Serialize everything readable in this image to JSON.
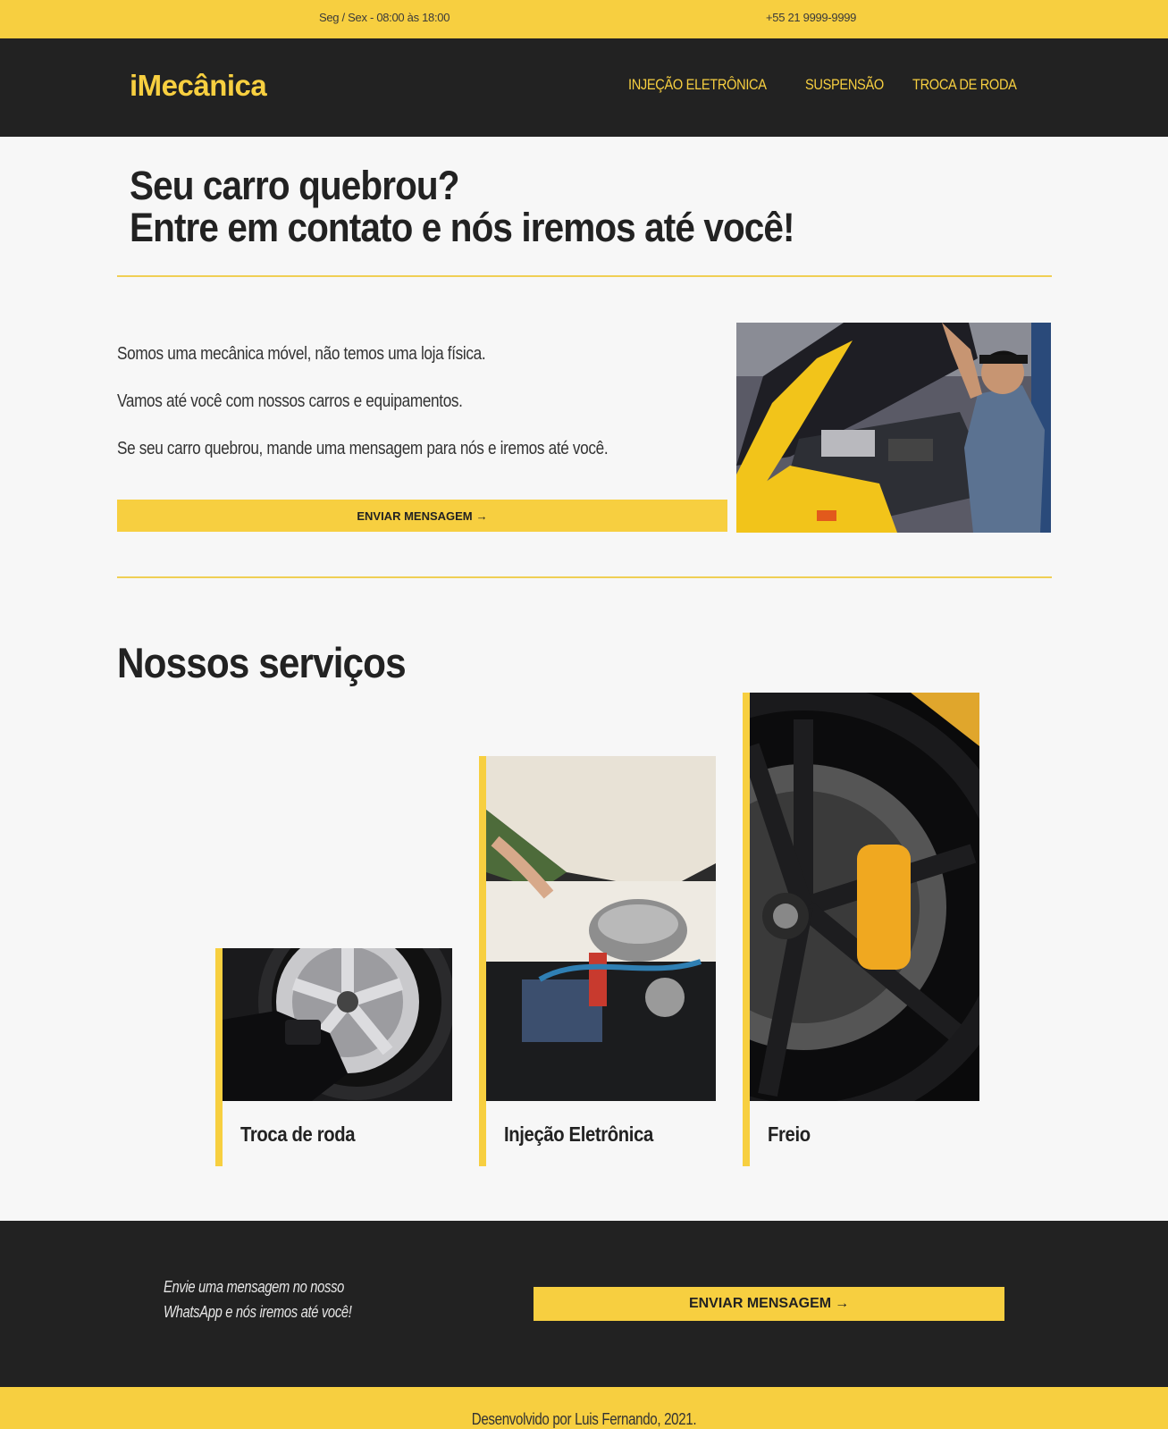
{
  "topbar": {
    "hours": "Seg / Sex - 08:00 às 18:00",
    "phone": "+55 21 9999-9999"
  },
  "header": {
    "logo": "iMecânica",
    "nav": [
      "Injeção Eletrônica",
      "Suspensão",
      "Troca de roda"
    ]
  },
  "hero": {
    "title_line1": "Seu carro quebrou?",
    "title_line2": "Entre em contato e nós iremos até você!"
  },
  "about": {
    "p1": "Somos uma mecânica móvel, não temos uma loja física.",
    "p2": "Vamos até você com nossos carros e equipamentos.",
    "p3": "Se seu carro quebrou, mande uma mensagem para nós e iremos até você.",
    "button": "ENVIAR MENSAGEM"
  },
  "services": {
    "title": "Nossos serviços",
    "items": [
      {
        "label": "Troca de roda"
      },
      {
        "label": "Injeção Eletrônica"
      },
      {
        "label": "Freio"
      }
    ]
  },
  "cta": {
    "line1": "Envie uma mensagem no nosso",
    "line2": "WhatsApp e nós iremos até você!",
    "button": "ENVIAR MENSAGEM"
  },
  "footer": {
    "credit": "Desenvolvido por Luis Fernando, 2021."
  },
  "colors": {
    "accent": "#f7cf40",
    "dark": "#222222",
    "background": "#f7f7f7"
  }
}
